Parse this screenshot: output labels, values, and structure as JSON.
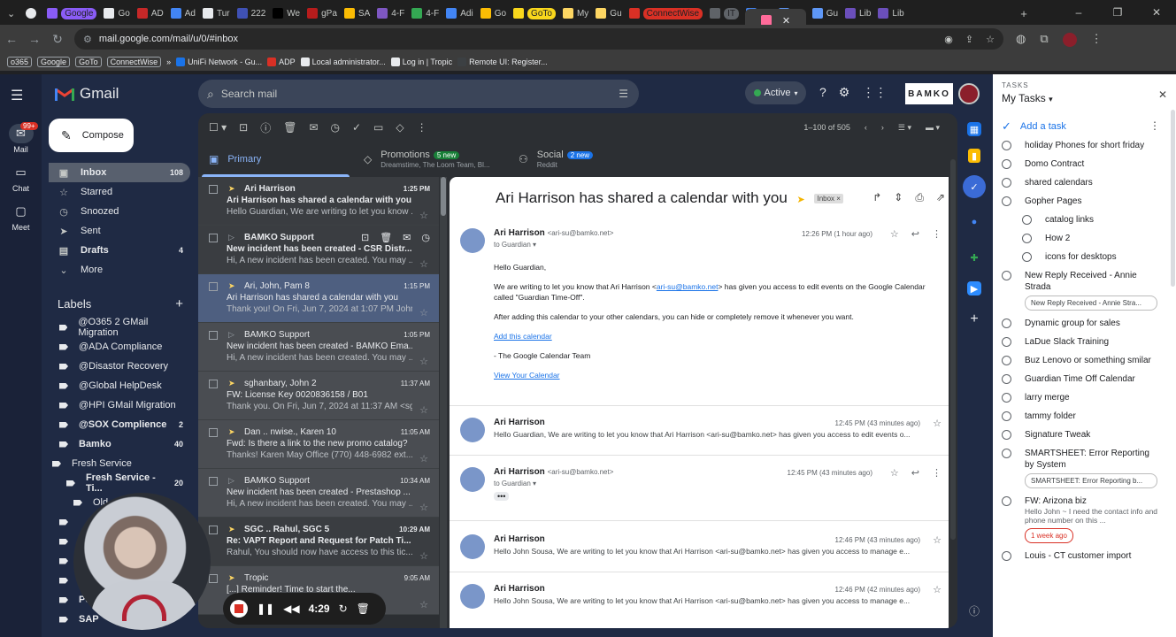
{
  "browser": {
    "tabs": [
      {
        "label": "Google",
        "color": "#8a5cf6",
        "pill": true
      },
      {
        "label": "Go",
        "color": "#e8eaed"
      },
      {
        "label": "",
        "color": "#ff6b9a",
        "active": true
      },
      {
        "label": "AD",
        "color": "#c62828"
      },
      {
        "label": "Ad",
        "color": "#4285f4"
      },
      {
        "label": "Tur",
        "color": "#e8eaed"
      },
      {
        "label": "222",
        "color": "#3f51b5"
      },
      {
        "label": "We",
        "color": "#000000"
      },
      {
        "label": "gPa",
        "color": "#b71c1c"
      },
      {
        "label": "SA",
        "color": "#fbbc04"
      },
      {
        "label": "4-F",
        "color": "#7e57c2"
      },
      {
        "label": "4-F",
        "color": "#34a853"
      },
      {
        "label": "Adi",
        "color": "#4285f4"
      },
      {
        "label": "Go",
        "color": "#fbbc04"
      },
      {
        "label": "GoTo",
        "color": "#f9d71c",
        "pill": true
      },
      {
        "label": "My",
        "color": "#fdd663"
      },
      {
        "label": "Gu",
        "color": "#fdd663"
      },
      {
        "label": "ConnectWise",
        "color": "#d93025",
        "pill": true
      },
      {
        "label": "IT",
        "color": "#5f6368",
        "pill": true
      },
      {
        "label": "My",
        "color": "#4285f4"
      },
      {
        "label": "Gu",
        "color": "#5e97f6"
      },
      {
        "label": "Gu",
        "color": "#5e97f6"
      },
      {
        "label": "Lib",
        "color": "#6b4fbb"
      },
      {
        "label": "Lib",
        "color": "#6b4fbb"
      }
    ],
    "url": "mail.google.com/mail/u/0/#inbox",
    "bookmarks": [
      {
        "label": "o365",
        "box": true
      },
      {
        "label": "Google",
        "box": true
      },
      {
        "label": "GoTo",
        "box": true
      },
      {
        "label": "ConnectWise",
        "box": true
      },
      {
        "label": "»"
      },
      {
        "label": "UniFi Network - Gu...",
        "color": "#1a73e8"
      },
      {
        "label": "ADP",
        "color": "#d93025"
      },
      {
        "label": "Local administrator...",
        "color": "#e8eaed"
      },
      {
        "label": "Log in | Tropic",
        "color": "#e8eaed"
      },
      {
        "label": "Remote UI: Register...",
        "color": "#3c4043"
      }
    ]
  },
  "rail": {
    "mail_badge": "99+",
    "items": [
      {
        "label": "Mail"
      },
      {
        "label": "Chat"
      },
      {
        "label": "Meet"
      }
    ]
  },
  "gmail": {
    "app_name": "Gmail",
    "compose": "Compose",
    "search_placeholder": "Search mail",
    "status": "Active",
    "brand": "BAMKO",
    "nav": [
      {
        "label": "Inbox",
        "count": "108",
        "icon": "inbox-icon",
        "glyph": "▣",
        "selected": true
      },
      {
        "label": "Starred",
        "count": "",
        "icon": "star-icon",
        "glyph": "☆"
      },
      {
        "label": "Snoozed",
        "count": "",
        "icon": "clock-icon",
        "glyph": "◷"
      },
      {
        "label": "Sent",
        "count": "",
        "icon": "send-icon",
        "glyph": "➤"
      },
      {
        "label": "Drafts",
        "count": "4",
        "icon": "draft-icon",
        "glyph": "▤",
        "bold": true
      },
      {
        "label": "More",
        "count": "",
        "icon": "chevron-down-icon",
        "glyph": "⌄"
      }
    ],
    "labels_title": "Labels",
    "labels": [
      {
        "label": "@O365 2 GMail Migration",
        "count": ""
      },
      {
        "label": "@ADA Compliance",
        "count": ""
      },
      {
        "label": "@Disastor Recovery",
        "count": ""
      },
      {
        "label": "@Global HelpDesk",
        "count": ""
      },
      {
        "label": "@HPI GMail Migration",
        "count": ""
      },
      {
        "label": "@SOX Complience",
        "count": "2",
        "bold": true
      },
      {
        "label": "Bamko",
        "count": "40",
        "bold": true
      },
      {
        "label": "Fresh Service",
        "count": ""
      },
      {
        "label": "Fresh Service - Ti...",
        "count": "20",
        "bold": true
      },
      {
        "label": "Old",
        "count": ""
      },
      {
        "label": "",
        "count": ""
      },
      {
        "label": "",
        "count": ""
      },
      {
        "label": "",
        "count": ""
      },
      {
        "label": "",
        "count": ""
      },
      {
        "label": "Po",
        "count": "",
        "bold": true
      },
      {
        "label": "SAP",
        "count": "",
        "bold": true
      }
    ],
    "pager": "1–100 of 505",
    "tabs": [
      {
        "label": "Primary",
        "sub": "",
        "pill": "",
        "icon": "inbox-tab-icon"
      },
      {
        "label": "Promotions",
        "sub": "Dreamstime, The Loom Team, Bl...",
        "pill": "5 new",
        "icon": "tag-icon"
      },
      {
        "label": "Social",
        "sub": "Reddit",
        "pill": "2 new",
        "icon": "people-icon"
      }
    ],
    "messages": [
      {
        "sender": "Ari Harrison",
        "time": "1:25 PM",
        "subject": "Ari Harrison has shared a calendar with you",
        "snippet": "Hello Guardian, We are writing to let you know ...",
        "state": "unread",
        "important": true
      },
      {
        "sender": "BAMKO Support",
        "time": "",
        "subject": "New incident has been created - CSR Distr...",
        "snippet": "Hi, A new incident has been created. You may ...",
        "state": "unread",
        "important": false
      },
      {
        "sender": "Ari, John, Pam 8",
        "time": "1:15 PM",
        "subject": "Ari Harrison has shared a calendar with you",
        "snippet": "Thank you! On Fri, Jun 7, 2024 at 1:07 PM John...",
        "state": "sel",
        "important": true
      },
      {
        "sender": "BAMKO Support",
        "time": "1:05 PM",
        "subject": "New incident has been created - BAMKO Ema...",
        "snippet": "Hi, A new incident has been created. You may ...",
        "state": "read",
        "important": false
      },
      {
        "sender": "sghanbary, John 2",
        "time": "11:37 AM",
        "subject": "FW: License Key 0020836158 / B01",
        "snippet": "Thank you. On Fri, Jun 7, 2024 at 11:37 AM <sg...",
        "state": "read",
        "important": true
      },
      {
        "sender": "Dan .. nwise., Karen 10",
        "time": "11:05 AM",
        "subject": "Fwd: Is there a link to the new promo catalog?",
        "snippet": "Thanks! Karen May Office (770) 448-6982 ext....",
        "state": "read",
        "important": true
      },
      {
        "sender": "BAMKO Support",
        "time": "10:34 AM",
        "subject": "New incident has been created - Prestashop ...",
        "snippet": "Hi, A new incident has been created. You may ...",
        "state": "read",
        "important": false
      },
      {
        "sender": "SGC .. Rahul, SGC 5",
        "time": "10:29 AM",
        "subject": "Re: VAPT Report and Request for Patch Ti...",
        "snippet": "Rahul, You should now have access to this tic...",
        "state": "unread",
        "important": true
      },
      {
        "sender": "Tropic",
        "time": "9:05 AM",
        "subject": "[...] Reminder! Time to start the...",
        "snippet": "...",
        "state": "read",
        "important": true
      }
    ],
    "reading": {
      "title": "Ari Harrison has shared a calendar with you",
      "inbox_tag": "Inbox ×",
      "first": {
        "from": "Ari Harrison",
        "email": "<ari-su@bamko.net>",
        "to": "to Guardian ▾",
        "when": "12:26 PM (1 hour ago)"
      },
      "body": {
        "greeting": "Hello Guardian,",
        "p1_pre": "We are writing to let you know that Ari Harrison <",
        "p1_link": "ari-su@bamko.net",
        "p1_post": "> has given you access to edit events on the Google Calendar called \"Guardian Time-Off\".",
        "p2": "After adding this calendar to your other calendars, you can hide or completely remove it whenever you want.",
        "add_link": "Add this calendar",
        "sign": "- The Google Calendar Team",
        "view_link": "View Your Calendar"
      },
      "thread": [
        {
          "from": "Ari Harrison",
          "when": "12:45 PM (43 minutes ago)",
          "preview": "Hello Guardian, We are writing to let you know that Ari Harrison <ari-su@bamko.net> has given you access to edit events o..."
        },
        {
          "from": "Ari Harrison",
          "email": "<ari-su@bamko.net>",
          "when": "12:45 PM (43 minutes ago)",
          "to": "to Guardian ▾"
        },
        {
          "from": "Ari Harrison",
          "when": "12:46 PM (43 minutes ago)",
          "preview": "Hello John Sousa, We are writing to let you know that Ari Harrison <ari-su@bamko.net> has given you access to manage e..."
        },
        {
          "from": "Ari Harrison",
          "when": "12:46 PM (42 minutes ago)",
          "preview": "Hello John Sousa, We are writing to let you know that Ari Harrison <ari-su@bamko.net> has given you access to manage e..."
        }
      ]
    }
  },
  "tasks": {
    "header": "TASKS",
    "list_name": "My Tasks",
    "add": "Add a task",
    "items": [
      {
        "title": "holiday Phones for short friday"
      },
      {
        "title": "Domo Contract"
      },
      {
        "title": "shared calendars"
      },
      {
        "title": "Gopher Pages"
      },
      {
        "title": "catalog links",
        "sub": true
      },
      {
        "title": "How 2",
        "sub": true
      },
      {
        "title": "icons for desktops",
        "sub": true
      },
      {
        "title": "New Reply Received - Annie Strada",
        "chip": "New Reply Received - Annie Stra..."
      },
      {
        "title": "Dynamic group for sales"
      },
      {
        "title": "LaDue Slack Training"
      },
      {
        "title": "Buz Lenovo or something smilar"
      },
      {
        "title": "Guardian Time Off Calendar"
      },
      {
        "title": "larry merge"
      },
      {
        "title": "tammy folder"
      },
      {
        "title": "Signature Tweak"
      },
      {
        "title": "SMARTSHEET: Error Reporting by System",
        "chip": "SMARTSHEET: Error Reporting b..."
      },
      {
        "title": "FW: Arizona biz",
        "note": "Hello John ~ I need the contact info and phone number on this ...",
        "due": "1 week ago"
      },
      {
        "title": "Louis - CT customer import"
      }
    ]
  },
  "player": {
    "time": "4:29"
  }
}
